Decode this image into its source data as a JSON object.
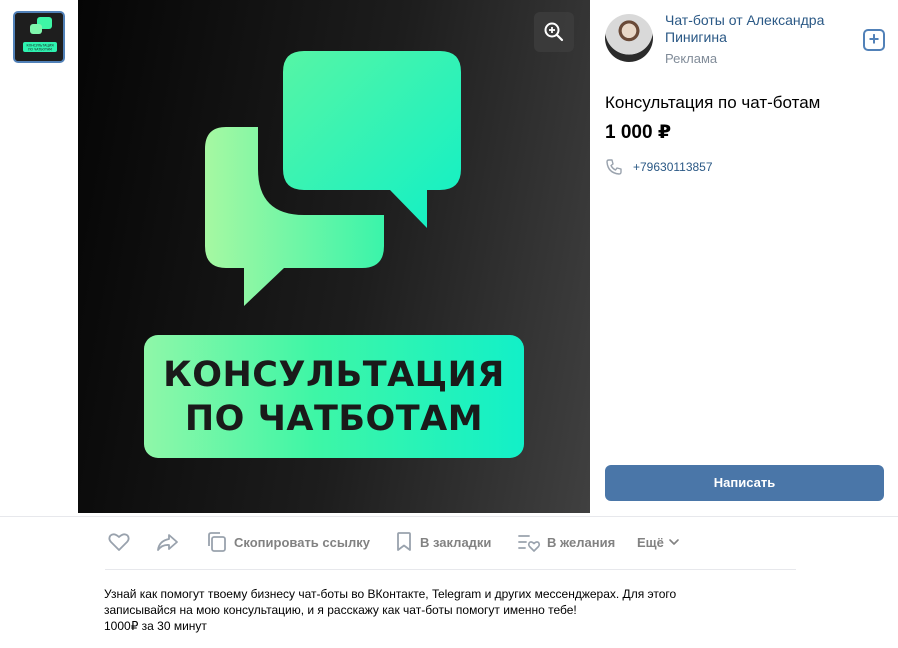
{
  "thumbnail": {
    "text": "КОНСУЛЬТАЦИЯ ПО ЧАТБОТАМ"
  },
  "image": {
    "caption_line1": "КОНСУЛЬТАЦИЯ",
    "caption_line2": "ПО ЧАТБОТАМ",
    "colors": {
      "accent_light": "#8ff7a8",
      "accent_dark": "#12f0c8",
      "background": "#111111"
    }
  },
  "seller": {
    "name": "Чат-боты от Александра Пинигина",
    "subtitle": "Реклама",
    "follow_label": "+"
  },
  "product": {
    "title": "Консультация по чат-ботам",
    "price": "1 000 ₽",
    "phone": "+79630113857"
  },
  "write_button": "Написать",
  "actions": {
    "copy_link": "Скопировать ссылку",
    "bookmarks": "В закладки",
    "wishlist": "В желания",
    "more": "Ещё"
  },
  "description": {
    "line1": "Узнай как помогут твоему бизнесу чат-боты во ВКонтакте, Telegram и других мессенджерах. Для этого",
    "line2": "записывайся на мою консультацию, и я расскажу как чат-боты помогут именно тебе!",
    "line3": "1000₽ за 30 минут"
  },
  "icons": [
    "zoom-in-icon",
    "plus-icon",
    "phone-icon",
    "heart-icon",
    "share-icon",
    "copy-icon",
    "bookmark-icon",
    "wishlist-icon",
    "chevron-down-icon"
  ],
  "colors": {
    "link": "#2a5885",
    "button": "#4a76a8",
    "muted": "#828282"
  }
}
